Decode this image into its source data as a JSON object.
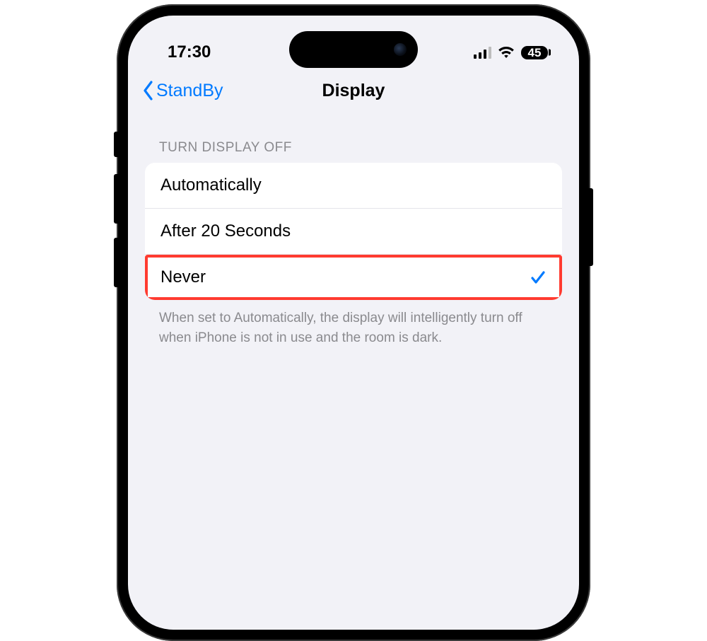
{
  "statusBar": {
    "time": "17:30",
    "batteryPercent": "45"
  },
  "nav": {
    "backLabel": "StandBy",
    "title": "Display"
  },
  "section": {
    "header": "TURN DISPLAY OFF",
    "options": {
      "automatically": "Automatically",
      "after20": "After 20 Seconds",
      "never": "Never"
    },
    "footer": "When set to Automatically, the display will intelligently turn off when iPhone is not in use and the room is dark."
  }
}
